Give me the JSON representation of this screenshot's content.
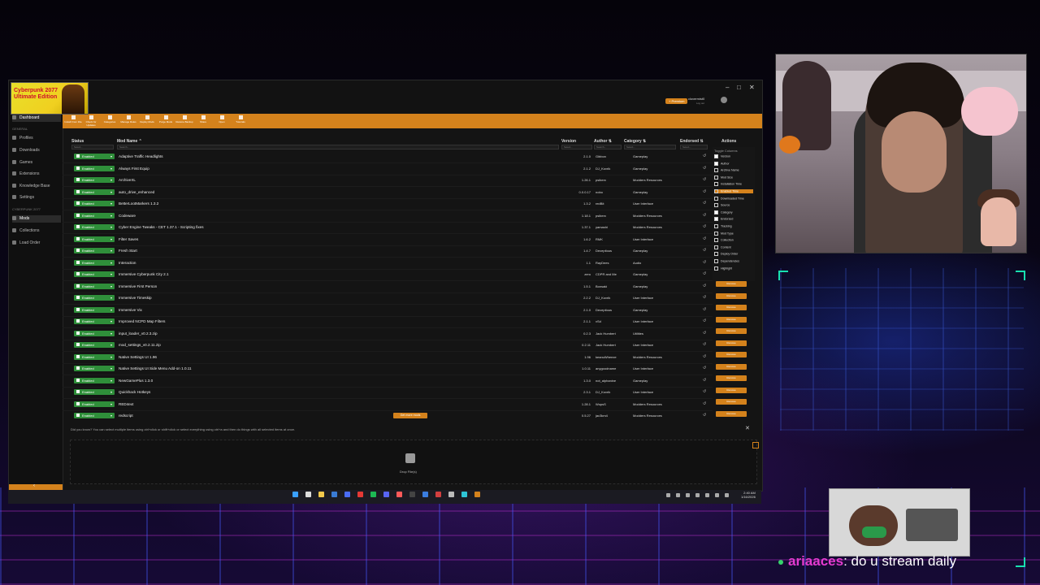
{
  "app": {
    "game_title": "Cyberpunk 2077 Ultimate Edition",
    "user_name": "clovermist0",
    "user_sub": "Log out",
    "premium_label": "+ Premium",
    "window_controls": [
      "–",
      "□",
      "✕"
    ]
  },
  "sidebar": {
    "items": [
      {
        "label": "Dashboard",
        "icon": "dashboard-icon"
      },
      {
        "label": "Profiles",
        "icon": "profiles-icon"
      },
      {
        "label": "Downloads",
        "icon": "downloads-icon"
      },
      {
        "label": "Games",
        "icon": "games-icon"
      },
      {
        "label": "Extensions",
        "icon": "extensions-icon"
      },
      {
        "label": "Knowledge Base",
        "icon": "knowledge-icon"
      },
      {
        "label": "Settings",
        "icon": "settings-icon"
      },
      {
        "label": "Mods",
        "icon": "mods-icon"
      },
      {
        "label": "Collections",
        "icon": "collections-icon"
      },
      {
        "label": "Load Order",
        "icon": "loadorder-icon"
      }
    ],
    "section_general": "General",
    "section_game": "Cyberpunk 2077"
  },
  "toolbar": {
    "buttons": [
      "Install From File",
      "Check for Updates",
      "Categories",
      "Manage Rules",
      "Deploy Mods",
      "Purge Mods",
      "Restore Backup",
      "Share",
      "Open",
      "Tutorials"
    ]
  },
  "table": {
    "headers": {
      "status": "Status",
      "name": "Mod Name ⌃",
      "version": "Version",
      "author": "Author ⇅",
      "category": "Category ⇅",
      "endorsed": "Endorsed ⇅",
      "actions": "Actions"
    },
    "filter_placeholder": "Select...",
    "filter_search": "Search...",
    "status_label": "Enabled",
    "rows": [
      {
        "name": "Adaptive Traffic Headlights",
        "version": "2.1.0",
        "author": "Gibbon",
        "category": "Gameplay"
      },
      {
        "name": "Always First Equip",
        "version": "2.1.2",
        "author": "DJ_Kovrik",
        "category": "Gameplay"
      },
      {
        "name": "ArchiveXL",
        "version": "1.26.1",
        "author": "psiberx",
        "category": "Modders Resources"
      },
      {
        "name": "auto_drive_enhanced",
        "version": "0.0.0.17",
        "author": "nobo",
        "category": "Gameplay"
      },
      {
        "name": "BetterLootMarkers 1.3.2",
        "version": "1.3.2",
        "author": "redBit",
        "category": "User Interface"
      },
      {
        "name": "Codeware",
        "version": "1.18.1",
        "author": "psiberx",
        "category": "Modders Resources"
      },
      {
        "name": "Cyber Engine Tweaks - CET 1.37.1 - Scripting fixes",
        "version": "1.37.1",
        "author": "yamashi",
        "category": "Modders Resources"
      },
      {
        "name": "Filter Saves",
        "version": "1.6.2",
        "author": "RMK",
        "category": "User Interface"
      },
      {
        "name": "Fresh Start",
        "version": "1.4.7",
        "author": "Deceptious",
        "category": "Gameplay"
      },
      {
        "name": "Interaction",
        "version": "1.1",
        "author": "RayDees",
        "category": "Audio"
      },
      {
        "name": "Immersive Cyberpunk City 2.1",
        "version": "zero",
        "author": "CDPR and Me",
        "category": "Gameplay"
      },
      {
        "name": "Immersive First Person",
        "version": "1.5.1",
        "author": "Bonsaki",
        "category": "Gameplay"
      },
      {
        "name": "Immersive Timeskip",
        "version": "2.2.2",
        "author": "DJ_Kovrik",
        "category": "User Interface"
      },
      {
        "name": "Immersive Vix",
        "version": "2.1.0",
        "author": "Deceptious",
        "category": "Gameplay"
      },
      {
        "name": "Improved NCPD Map Filters",
        "version": "2.1.1",
        "author": "vSd",
        "category": "User Interface"
      },
      {
        "name": "input_loader_v0.2.3.zip",
        "version": "0.2.3",
        "author": "Jack Humbert",
        "category": "Utilities"
      },
      {
        "name": "mod_settings_v0.2.11.zip",
        "version": "0.2.11",
        "author": "Jack Humbert",
        "category": "User Interface"
      },
      {
        "name": "Native Settings UI 1.96",
        "version": "1.96",
        "author": "keanuWheeze",
        "category": "Modders Resources"
      },
      {
        "name": "Native Settings UI Side Menu Add-on 1.0.11",
        "version": "1.0.11",
        "author": "anygoodname",
        "category": "User Interface"
      },
      {
        "name": "NewGamePlus 1.3.0",
        "version": "1.3.0",
        "author": "not_alphanine",
        "category": "Gameplay"
      },
      {
        "name": "Quickhack Hotkeys",
        "version": "2.3.1",
        "author": "DJ_Kovrik",
        "category": "User Interface"
      },
      {
        "name": "RED4ext",
        "version": "1.28.1",
        "author": "WopsS",
        "category": "Modders Resources"
      },
      {
        "name": "redscript",
        "version": "0.5.27",
        "author": "jac3km4",
        "category": "Modders Resources"
      }
    ],
    "remove_label": "Remove",
    "get_more_label": "Get more mods"
  },
  "toggle_columns": {
    "title": "Toggle Columns",
    "items": [
      {
        "label": "Version",
        "checked": true
      },
      {
        "label": "Author",
        "checked": true
      },
      {
        "label": "Archive Name",
        "checked": false
      },
      {
        "label": "Mod Size",
        "checked": false
      },
      {
        "label": "Installation Time",
        "checked": false
      },
      {
        "label": "Enabled Time",
        "checked": false,
        "highlight": true
      },
      {
        "label": "Downloaded Time",
        "checked": false
      },
      {
        "label": "Source",
        "checked": false
      },
      {
        "label": "Category",
        "checked": true
      },
      {
        "label": "Endorsed",
        "checked": true
      },
      {
        "label": "Tracking",
        "checked": false
      },
      {
        "label": "Mod Type",
        "checked": false
      },
      {
        "label": "Collection",
        "checked": false
      },
      {
        "label": "Content",
        "checked": false
      },
      {
        "label": "Deploy Order",
        "checked": false
      },
      {
        "label": "Dependencies",
        "checked": false
      },
      {
        "label": "Highlight",
        "checked": false
      }
    ]
  },
  "tip": "Did you know? You can select multiple items using ctrl+click or shift+click or select everything using ctrl+a and then do things with all selected items at once.",
  "dropzone_label": "Drop File(s)",
  "taskbar": {
    "time": "2:40 AM",
    "date": "1/16/2026"
  },
  "chat": {
    "user": "ariaaces",
    "message": ": do u stream daily"
  },
  "colors": {
    "accent": "#d4821c",
    "enabled": "#2f8f3a",
    "chat_user": "#e43bd0",
    "corner": "#18e0b0"
  }
}
